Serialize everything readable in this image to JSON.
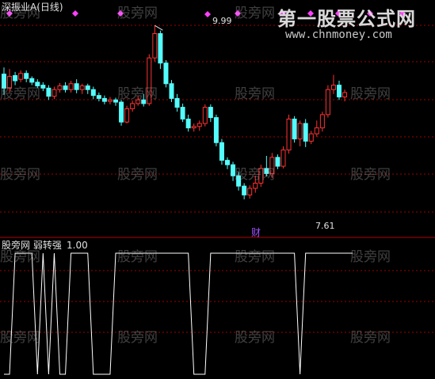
{
  "title": "深振业A(日线)",
  "indicator": {
    "name": "股旁网 弱转强",
    "value": "1.00"
  },
  "annotations": {
    "high": "9.99",
    "low": "7.61",
    "cai": "财"
  },
  "watermark": "股旁网",
  "brand": {
    "name": "第一股票公式网",
    "url": "www.chnmoney.com"
  },
  "colors": {
    "up": "#ff3232",
    "down": "#54fcfc",
    "grid": "#a00000",
    "line": "#ffffff",
    "marker": "#ff40ff"
  },
  "chart_data": {
    "type": "candlestick",
    "price_range": [
      7.2,
      10.25
    ],
    "annotated_high": 9.99,
    "annotated_low": 7.61,
    "candles": [
      [
        9.33,
        9.14,
        9.42,
        9.05
      ],
      [
        9.14,
        9.3,
        9.4,
        9.08
      ],
      [
        9.31,
        9.24,
        9.36,
        9.18
      ],
      [
        9.26,
        9.34,
        9.38,
        9.22
      ],
      [
        9.34,
        9.27,
        9.38,
        9.22
      ],
      [
        9.27,
        9.22,
        9.3,
        9.18
      ],
      [
        9.22,
        9.17,
        9.26,
        9.14
      ],
      [
        9.18,
        9.14,
        9.22,
        9.1
      ],
      [
        9.14,
        9.03,
        9.18,
        8.98
      ],
      [
        9.03,
        9.12,
        9.16,
        8.99
      ],
      [
        9.12,
        9.17,
        9.21,
        9.08
      ],
      [
        9.17,
        9.12,
        9.22,
        9.08
      ],
      [
        9.12,
        9.2,
        9.24,
        9.08
      ],
      [
        9.2,
        9.12,
        9.26,
        9.07
      ],
      [
        9.12,
        9.17,
        9.2,
        9.06
      ],
      [
        9.17,
        9.12,
        9.2,
        9.06
      ],
      [
        9.12,
        9.04,
        9.16,
        8.99
      ],
      [
        9.04,
        9.0,
        9.08,
        8.96
      ],
      [
        9.0,
        8.96,
        9.04,
        8.92
      ],
      [
        8.96,
        8.98,
        9.02,
        8.92
      ],
      [
        8.98,
        8.95,
        9.01,
        8.9
      ],
      [
        8.95,
        8.68,
        8.98,
        8.63
      ],
      [
        8.68,
        8.86,
        8.9,
        8.66
      ],
      [
        8.86,
        8.93,
        8.97,
        8.82
      ],
      [
        8.93,
        8.98,
        9.03,
        8.9
      ],
      [
        8.98,
        8.93,
        9.06,
        8.89
      ],
      [
        8.93,
        9.55,
        9.6,
        8.9
      ],
      [
        9.55,
        9.88,
        9.99,
        9.5
      ],
      [
        9.88,
        9.48,
        9.92,
        9.4
      ],
      [
        9.48,
        9.2,
        9.52,
        9.15
      ],
      [
        9.2,
        9.0,
        9.25,
        8.95
      ],
      [
        9.0,
        8.88,
        9.06,
        8.82
      ],
      [
        8.88,
        8.72,
        8.93,
        8.68
      ],
      [
        8.72,
        8.6,
        8.78,
        8.55
      ],
      [
        8.6,
        8.62,
        8.66,
        8.55
      ],
      [
        8.62,
        8.66,
        8.7,
        8.56
      ],
      [
        8.66,
        8.88,
        8.92,
        8.62
      ],
      [
        8.88,
        8.74,
        8.92,
        8.68
      ],
      [
        8.74,
        8.4,
        8.78,
        8.35
      ],
      [
        8.4,
        8.16,
        8.45,
        8.1
      ],
      [
        8.16,
        8.1,
        8.2,
        8.04
      ],
      [
        8.1,
        7.95,
        8.14,
        7.88
      ],
      [
        7.95,
        7.81,
        8.0,
        7.75
      ],
      [
        7.81,
        7.69,
        7.85,
        7.63
      ],
      [
        7.69,
        7.78,
        7.82,
        7.64
      ],
      [
        7.78,
        7.85,
        7.95,
        7.72
      ],
      [
        7.85,
        8.05,
        8.1,
        7.8
      ],
      [
        8.05,
        7.98,
        8.22,
        7.94
      ],
      [
        7.98,
        8.2,
        8.26,
        7.92
      ],
      [
        8.2,
        8.08,
        8.24,
        8.04
      ],
      [
        8.08,
        8.3,
        8.35,
        8.05
      ],
      [
        8.3,
        8.72,
        8.78,
        8.25
      ],
      [
        8.72,
        8.45,
        8.76,
        8.4
      ],
      [
        8.45,
        8.66,
        8.7,
        8.35
      ],
      [
        8.66,
        8.42,
        8.72,
        8.34
      ],
      [
        8.42,
        8.52,
        8.56,
        8.38
      ],
      [
        8.52,
        8.6,
        8.7,
        8.48
      ],
      [
        8.6,
        8.78,
        8.82,
        8.55
      ],
      [
        8.78,
        9.12,
        9.18,
        8.74
      ],
      [
        9.12,
        9.18,
        9.32,
        9.06
      ],
      [
        9.18,
        9.02,
        9.24,
        8.98
      ],
      [
        9.02,
        9.08,
        9.12,
        8.96
      ]
    ],
    "indicator_range": [
      0,
      1
    ],
    "indicator_series": [
      0,
      0,
      1,
      1,
      1,
      1,
      0,
      1,
      0,
      1,
      0,
      0,
      1,
      1,
      1,
      1,
      0,
      0,
      0,
      0,
      1,
      1,
      1,
      1,
      1,
      1,
      1,
      1,
      1,
      1,
      1,
      1,
      1,
      1,
      0,
      0,
      0,
      1,
      1,
      1,
      1,
      1,
      1,
      1,
      1,
      1,
      1,
      1,
      1,
      1,
      1,
      1,
      1,
      0,
      1,
      1,
      1,
      1,
      1,
      1,
      1,
      1
    ]
  }
}
